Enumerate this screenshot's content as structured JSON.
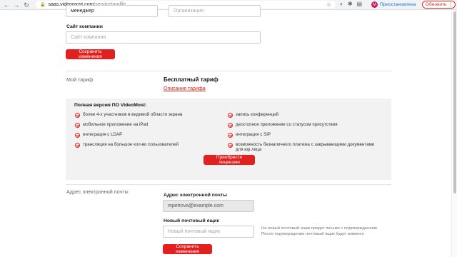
{
  "browser": {
    "back": "←",
    "forward": "→",
    "reload": "↻",
    "lock": "🔒",
    "url_host": "saas.videomost.com",
    "url_path": "/service/profile",
    "profile_initial": "M",
    "profile_status": "Приостановлена",
    "update_label": "Обновить",
    "menu": "⋮"
  },
  "top_fields": {
    "position_value": "менеджер",
    "organization_placeholder": "Организация"
  },
  "company_site": {
    "label": "Сайт компании",
    "placeholder": "Сайт компании",
    "save_label": "Сохранить изменения"
  },
  "tariff": {
    "section_label": "Мой тариф",
    "name": "Бесплатный тариф",
    "description_link": "Описание тарифа",
    "features_title": "Полная версия ПО VideoMost:",
    "features_left": [
      "более 4-х участников в видимой области экрана",
      "мобильное приложение на iPad",
      "интеграция с LDAP",
      "трансляция на большое кол-во пользователей"
    ],
    "features_right": [
      "запись конференций",
      "десктопное приложение со статусом присутствия",
      "интеграция с SIP",
      "возможность безналичного платежа с закрывающими документами для юр.лица"
    ],
    "buy_label": "Приобрести лицензию"
  },
  "email": {
    "section_label": "Адрес электронной почты",
    "current_label": "Адрес электронной почты",
    "current_value": "mpetrova@example.com",
    "new_label": "Новый почтовый ящик",
    "new_placeholder": "Новый почтовый ящик",
    "hint": "На новый почтовый ящик придет письмо с подтверждением. После подтверждения почтовый ящик будет изменен",
    "save_label": "Сохранить изменения"
  },
  "colors": {
    "accent_red": "#e32020",
    "link_red": "#d9261c"
  }
}
